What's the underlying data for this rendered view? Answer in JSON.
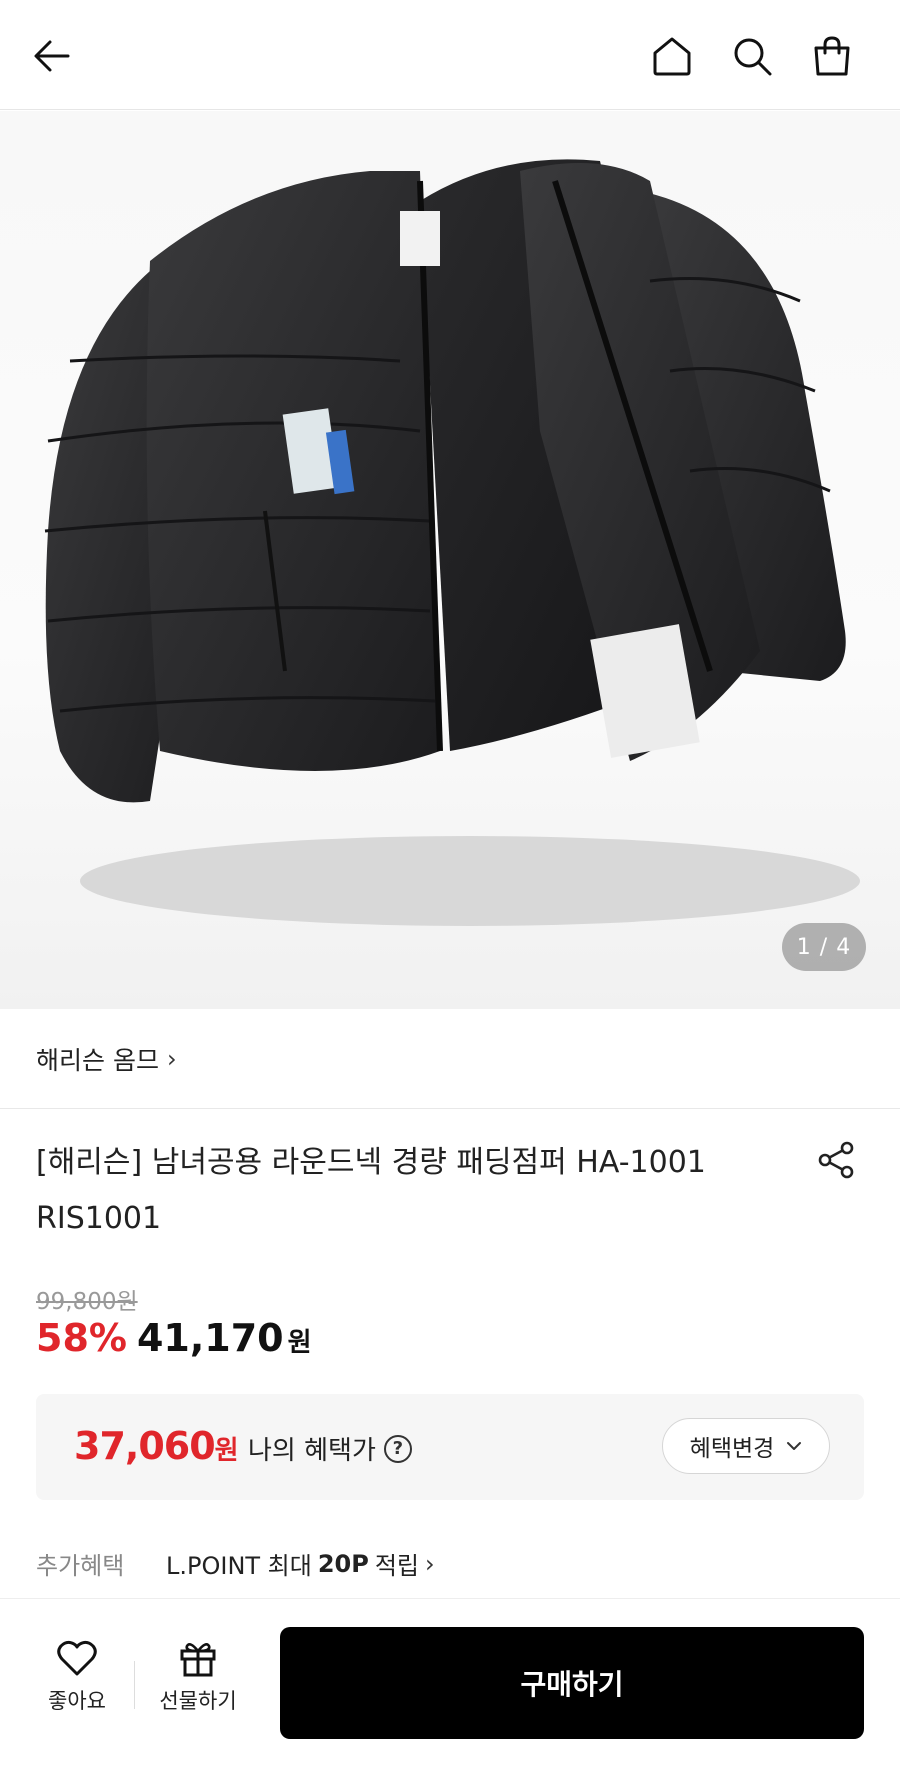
{
  "header": {
    "icons": [
      "back-arrow-icon",
      "home-icon",
      "search-icon",
      "shopping-bag-icon"
    ]
  },
  "gallery": {
    "pager": "1 / 4"
  },
  "brand": {
    "name": "해리슨 옴므"
  },
  "product": {
    "title": "[해리슨] 남녀공용 라운드넥 경량 패딩점퍼 HA-1001 RIS1001"
  },
  "price": {
    "original": "99,800원",
    "discount": "58%",
    "sale": "41,170",
    "unit": "원"
  },
  "benefit": {
    "price": "37,060",
    "unit": "원",
    "label": "나의 혜택가",
    "change_button": "혜택변경"
  },
  "extra_benefit": {
    "label": "추가혜택",
    "text_prefix": "L.POINT 최대",
    "points": "20P",
    "text_suffix": "적립"
  },
  "bottom_bar": {
    "like_label": "좋아요",
    "gift_label": "선물하기",
    "buy_label": "구매하기"
  },
  "colors": {
    "accent_red": "#e0262b",
    "buy_button": "#000000"
  }
}
